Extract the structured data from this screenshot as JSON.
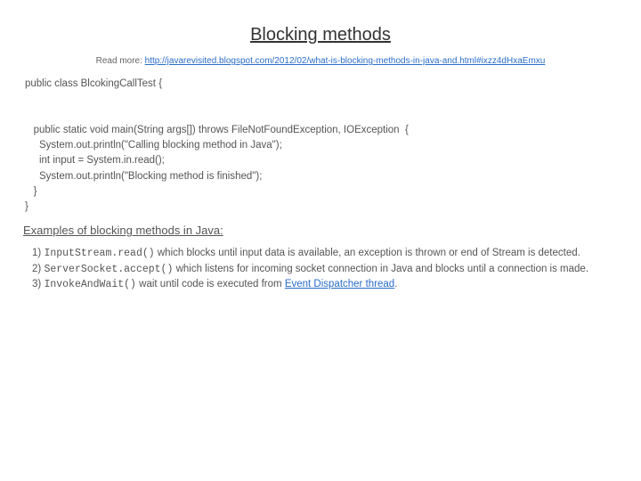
{
  "title": "Blocking methods",
  "readmore": {
    "label": "Read more:",
    "url": "http://javarevisited.blogspot.com/2012/02/what-is-blocking-methods-in-java-and.html#ixzz4dHxaEmxu"
  },
  "code": "public class BlcokingCallTest {\n\n\n   public static void main(String args[]) throws FileNotFoundException, IOException  {\n     System.out.println(\"Calling blocking method in Java\");\n     int input = System.in.read();\n     System.out.println(\"Blocking method is finished\");\n   }  \n}",
  "subheading": "Examples of blocking methods in Java:",
  "examples": [
    {
      "num": "1)",
      "api": "InputStream.read()",
      "desc": " which blocks until input data is available, an exception is thrown or end of Stream is detected."
    },
    {
      "num": "2)",
      "api": "ServerSocket.accept()",
      "desc": " which listens for incoming socket connection in Java and blocks until a connection is made."
    },
    {
      "num": "3)",
      "api": "InvokeAndWait()",
      "desc_prefix": " wait until code is executed from ",
      "link_text": "Event Dispatcher thread",
      "desc_suffix": "."
    }
  ]
}
